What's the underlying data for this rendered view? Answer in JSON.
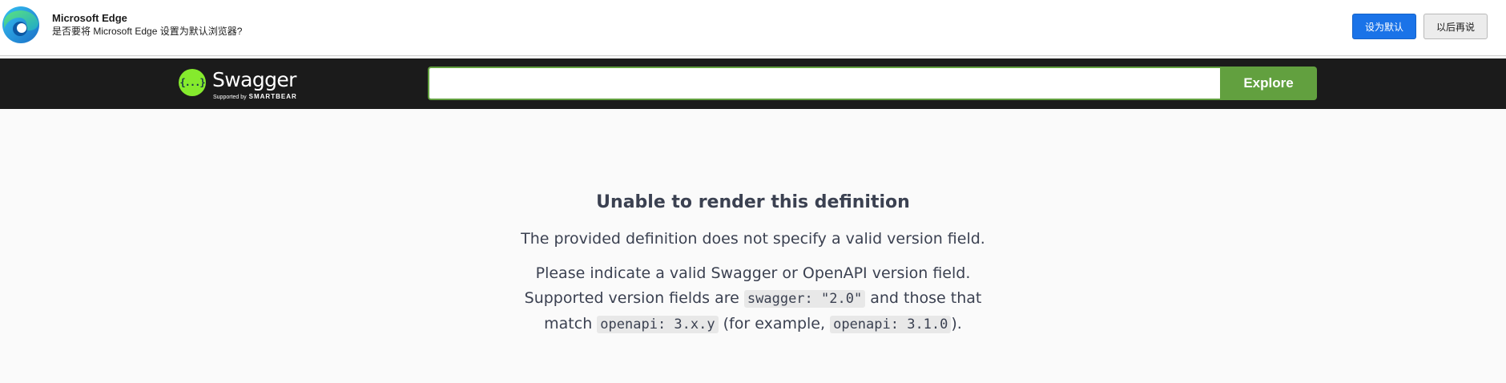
{
  "edge_banner": {
    "title": "Microsoft Edge",
    "subtitle": "是否要将 Microsoft Edge 设置为默认浏览器?",
    "primary_button": "设为默认",
    "secondary_button": "以后再说",
    "logo_icon": "edge-logo-icon"
  },
  "topbar": {
    "logo_badge": "{...}",
    "logo_text": "Swagger",
    "supported_by": "Supported by",
    "supported_brand": "SMARTBEAR",
    "url_value": "",
    "explore_label": "Explore",
    "colors": {
      "bar": "#1b1b1b",
      "accent": "#62a03f",
      "logo": "#85ea2d"
    }
  },
  "error": {
    "title": "Unable to render this definition",
    "line1": "The provided definition does not specify a valid version field.",
    "p2_line1": "Please indicate a valid Swagger or OpenAPI version field.",
    "p2_line2_a": "Supported version fields are",
    "code_swagger": "swagger: \"2.0\"",
    "p2_line2_b": "and those that",
    "p2_line3_a": "match",
    "code_openapi_pattern": "openapi: 3.x.y",
    "p2_line3_b": "(for example,",
    "code_openapi_example": "openapi: 3.1.0",
    "p2_line3_c": ")."
  }
}
